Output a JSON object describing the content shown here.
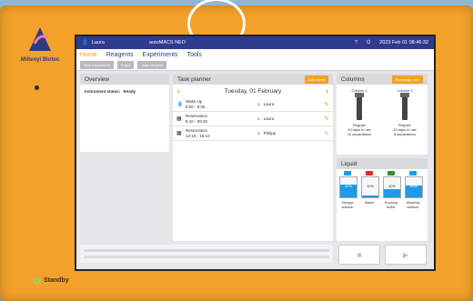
{
  "device": {
    "brand": "Miltenyi Biotec",
    "standby_label": "Standby"
  },
  "topbar": {
    "user": "Laura",
    "model": "autoMACS NEO",
    "help": "?",
    "power": "⏻",
    "datetime": "2023 Feb 01  08:46:32"
  },
  "menu": {
    "items": [
      "Home",
      "Reagents",
      "Experiments",
      "Tools"
    ]
  },
  "subbar": {
    "buttons": [
      "New experiment",
      "Prime",
      "Scan reagent"
    ]
  },
  "overview": {
    "title": "Overview",
    "status_label": "Instrument status:",
    "status_value": "Ready"
  },
  "planner": {
    "title": "Task planner",
    "add_button": "Add event",
    "date": "Tuesday, 01 February",
    "tasks": [
      {
        "icon": "drop-icon",
        "name": "Wake Up",
        "time": "8:00 - 8:05",
        "user": "Laura"
      },
      {
        "icon": "calendar-icon",
        "name": "Reservation",
        "time": "8:10 - 09:30",
        "user": "Laura"
      },
      {
        "icon": "calendar-icon",
        "name": "Reservation",
        "time": "12:10 - 16:10",
        "user": "Philipp"
      }
    ]
  },
  "columns": {
    "title": "Columns",
    "button": "Exchange now",
    "items": [
      {
        "name": "Column 1",
        "type": "Regular",
        "l1": "10 days in use",
        "l2": "12 separations"
      },
      {
        "name": "Column 2",
        "type": "Regular",
        "l1": "10 days in use",
        "l2": "8 separations"
      }
    ]
  },
  "liquid": {
    "title": "Liquid",
    "bottles": [
      {
        "name": "Storage solution",
        "level": "62%",
        "fill": 0.62,
        "cap": "#1e9be8"
      },
      {
        "name": "Waste",
        "level": "10%",
        "fill": 0.1,
        "cap": "#e02c2c"
      },
      {
        "name": "Running buffer",
        "level": "40%",
        "fill": 0.4,
        "cap": "#2e8c3a"
      },
      {
        "name": "Washing solution",
        "level": "60%",
        "fill": 0.6,
        "cap": "#1e9be8"
      }
    ]
  },
  "controls": {
    "stop": "■",
    "play": "▶"
  }
}
